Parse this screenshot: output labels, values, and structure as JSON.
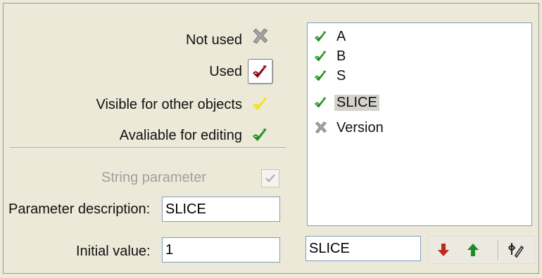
{
  "legend": {
    "not_used": "Not used",
    "used": "Used",
    "visible": "Visible for other objects",
    "editing": "Avaliable for editing"
  },
  "form": {
    "string_parameter_label": "String parameter",
    "description_label": "Parameter description:",
    "description_value": "SLICE",
    "initial_label": "Initial value:",
    "initial_value": "1",
    "name_value": "SLICE"
  },
  "parameters": [
    {
      "name": "A",
      "state": "editing",
      "selected": false
    },
    {
      "name": "B",
      "state": "editing",
      "selected": false
    },
    {
      "name": "S",
      "state": "editing",
      "selected": false
    },
    {
      "name": "SLICE",
      "state": "editing",
      "selected": true
    },
    {
      "name": "Version",
      "state": "not-used",
      "selected": false
    }
  ],
  "colors": {
    "used": "#8b0a1a",
    "visible": "#f2e21a",
    "editing": "#1f8f1f",
    "not_used": "#9a9a9a",
    "move_down": "#c0281c",
    "move_up": "#1c8c2a"
  },
  "icons": {
    "not_used": "not-used-icon",
    "used": "used-icon",
    "visible": "visible-icon",
    "editing": "editing-icon",
    "move_down": "arrow-down-icon",
    "move_up": "arrow-up-icon",
    "edit": "edit-icon"
  }
}
